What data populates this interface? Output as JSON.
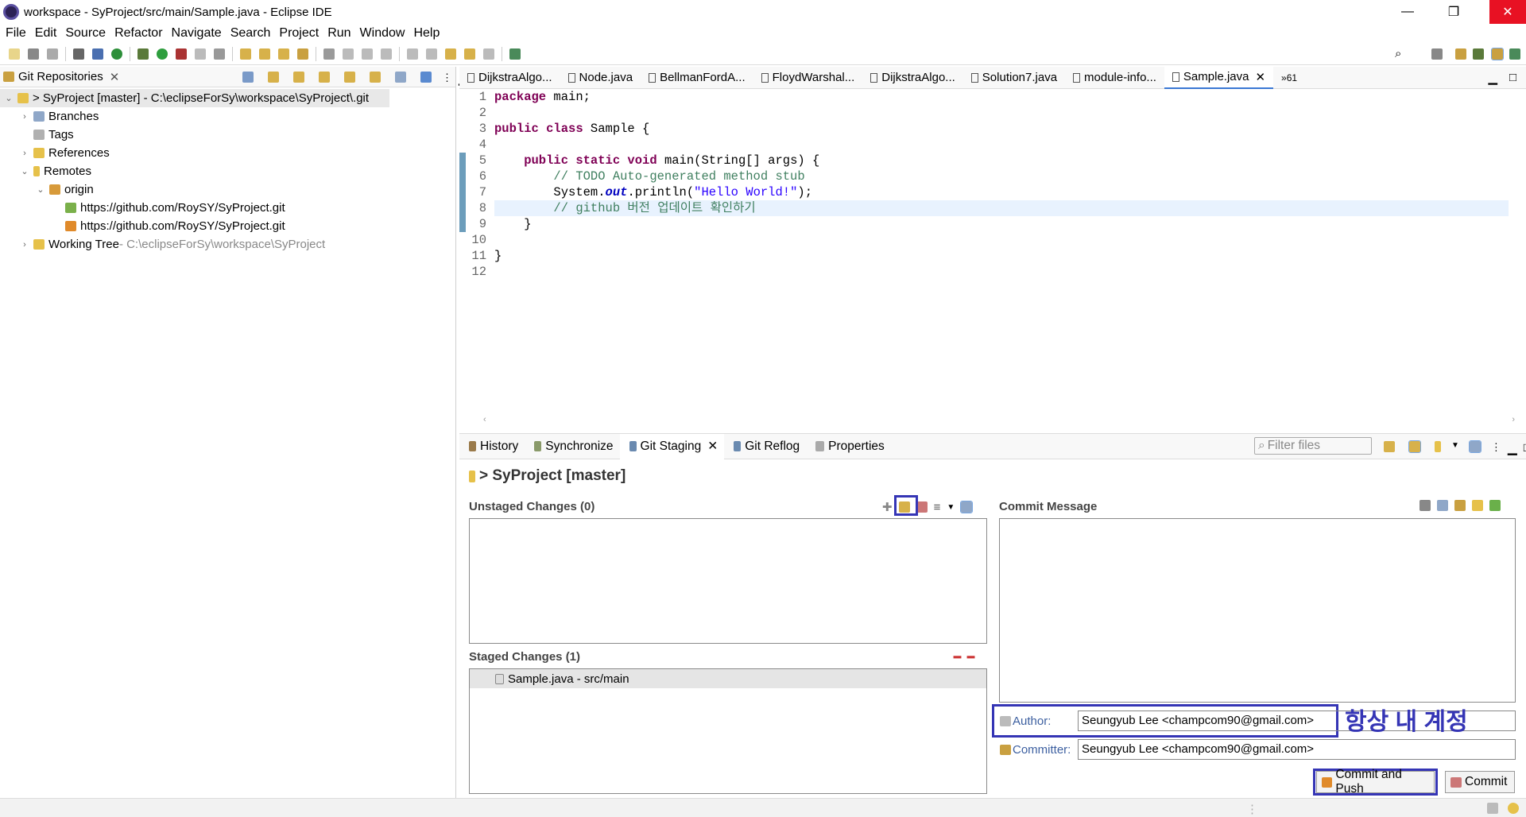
{
  "window": {
    "title": "workspace - SyProject/src/main/Sample.java - Eclipse IDE",
    "minimize": "—",
    "restore": "❐",
    "close": "✕"
  },
  "menu": [
    "File",
    "Edit",
    "Source",
    "Refactor",
    "Navigate",
    "Search",
    "Project",
    "Run",
    "Window",
    "Help"
  ],
  "git_repos": {
    "tab_label": "Git Repositories",
    "repo": "> SyProject [master] - C:\\eclipseForSy\\workspace\\SyProject\\.git",
    "branches": "Branches",
    "tags": "Tags",
    "references": "References",
    "remotes": "Remotes",
    "origin": "origin",
    "remote_url_1": "https://github.com/RoySY/SyProject.git",
    "remote_url_2": "https://github.com/RoySY/SyProject.git",
    "working_tree": "Working Tree",
    "working_tree_path": " - C:\\eclipseForSy\\workspace\\SyProject"
  },
  "editor": {
    "tabs": [
      "DijkstraAlgo...",
      "Node.java",
      "BellmanFordA...",
      "FloydWarshal...",
      "DijkstraAlgo...",
      "Solution7.java",
      "module-info...",
      "Sample.java"
    ],
    "overflow": "»61",
    "line_numbers": [
      "1",
      "2",
      "3",
      "4",
      "5",
      "6",
      "7",
      "8",
      "9",
      "10",
      "11",
      "12"
    ],
    "code": {
      "l1_kw": "package",
      "l1_rest": " main;",
      "l3_kw": "public class",
      "l3_rest": " Sample {",
      "l5_kw": "    public static void",
      "l5_rest": " main(String[] args) {",
      "l6": "        // TODO Auto-generated method stub",
      "l7_a": "        System.",
      "l7_b": "out",
      "l7_c": ".println(",
      "l7_str": "\"Hello World!\"",
      "l7_d": ");",
      "l8": "        // github 버전 업데이트 확인하기",
      "l9": "    }",
      "l11": "}"
    }
  },
  "bottom_panel": {
    "tabs": [
      "History",
      "Synchronize",
      "Git Staging",
      "Git Reflog",
      "Properties"
    ],
    "filter_placeholder": "Filter files",
    "repo_title": "> SyProject [master]",
    "unstaged_title": "Unstaged Changes (0)",
    "staged_title": "Staged Changes (1)",
    "staged_items": [
      "Sample.java - src/main"
    ],
    "commit_message_title": "Commit Message",
    "author_label": "Author:",
    "author_value": "Seungyub Lee <champcom90@gmail.com>",
    "committer_label": "Committer:",
    "committer_value": "Seungyub Lee <champcom90@gmail.com>",
    "annotation": "항상 내 계정",
    "commit_push_button": "Commit and Push",
    "commit_button": "Commit"
  },
  "colors": {
    "annotation_blue": "#3535b5",
    "selection": "#e8f2fe",
    "link_label": "#3c5fa0"
  }
}
